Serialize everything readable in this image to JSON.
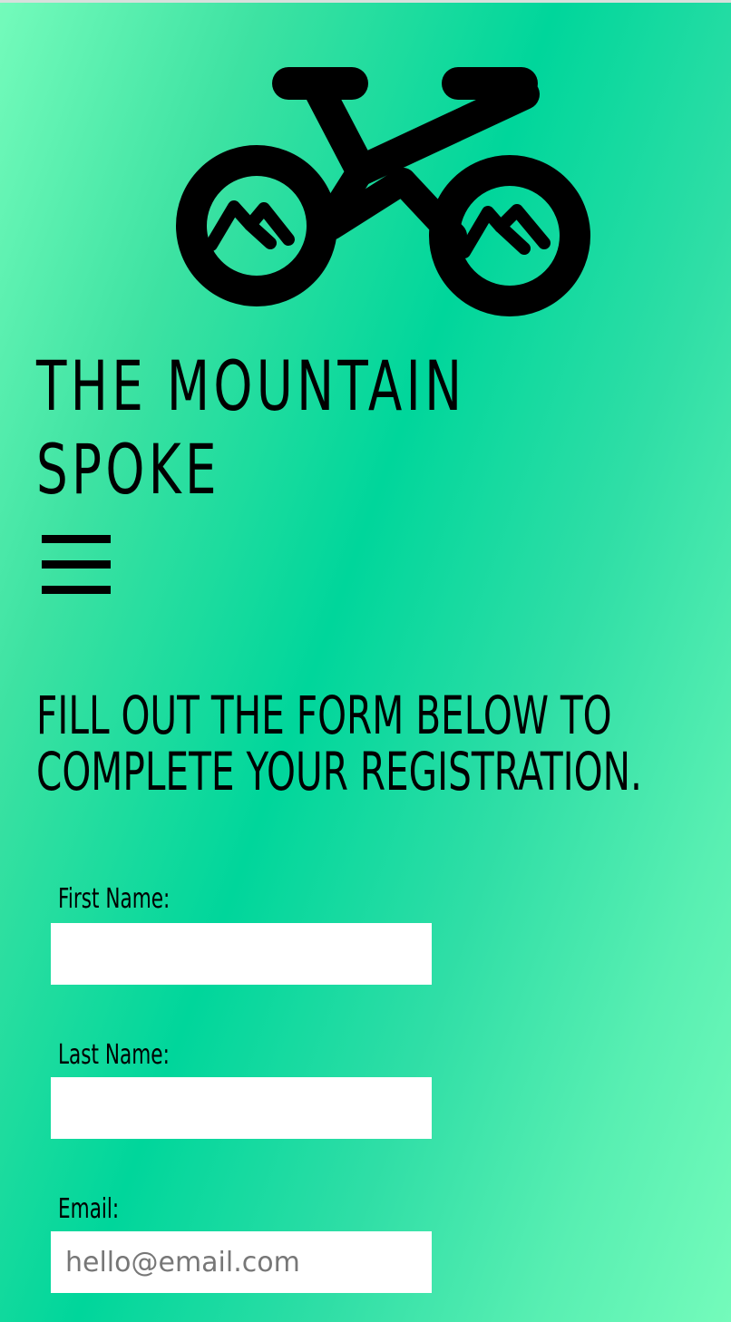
{
  "brand": {
    "logo_icon": "mountain-bike-icon",
    "title_line1": "THE MOUNTAIN",
    "title_line2": "SPOKE"
  },
  "nav": {
    "menu_icon": "hamburger-menu-icon"
  },
  "page": {
    "headline_line1": "FILL OUT THE FORM BELOW TO",
    "headline_line2": "COMPLETE YOUR REGISTRATION."
  },
  "form": {
    "first_name": {
      "label": "First Name:",
      "value": "",
      "placeholder": ""
    },
    "last_name": {
      "label": "Last Name:",
      "value": "",
      "placeholder": ""
    },
    "email": {
      "label": "Email:",
      "value": "",
      "placeholder": "hello@email.com"
    }
  },
  "colors": {
    "background_light": "#74fbbb",
    "background_mid": "#00d69b",
    "foreground": "#000000",
    "input_background": "#ffffff",
    "placeholder": "#777777"
  }
}
